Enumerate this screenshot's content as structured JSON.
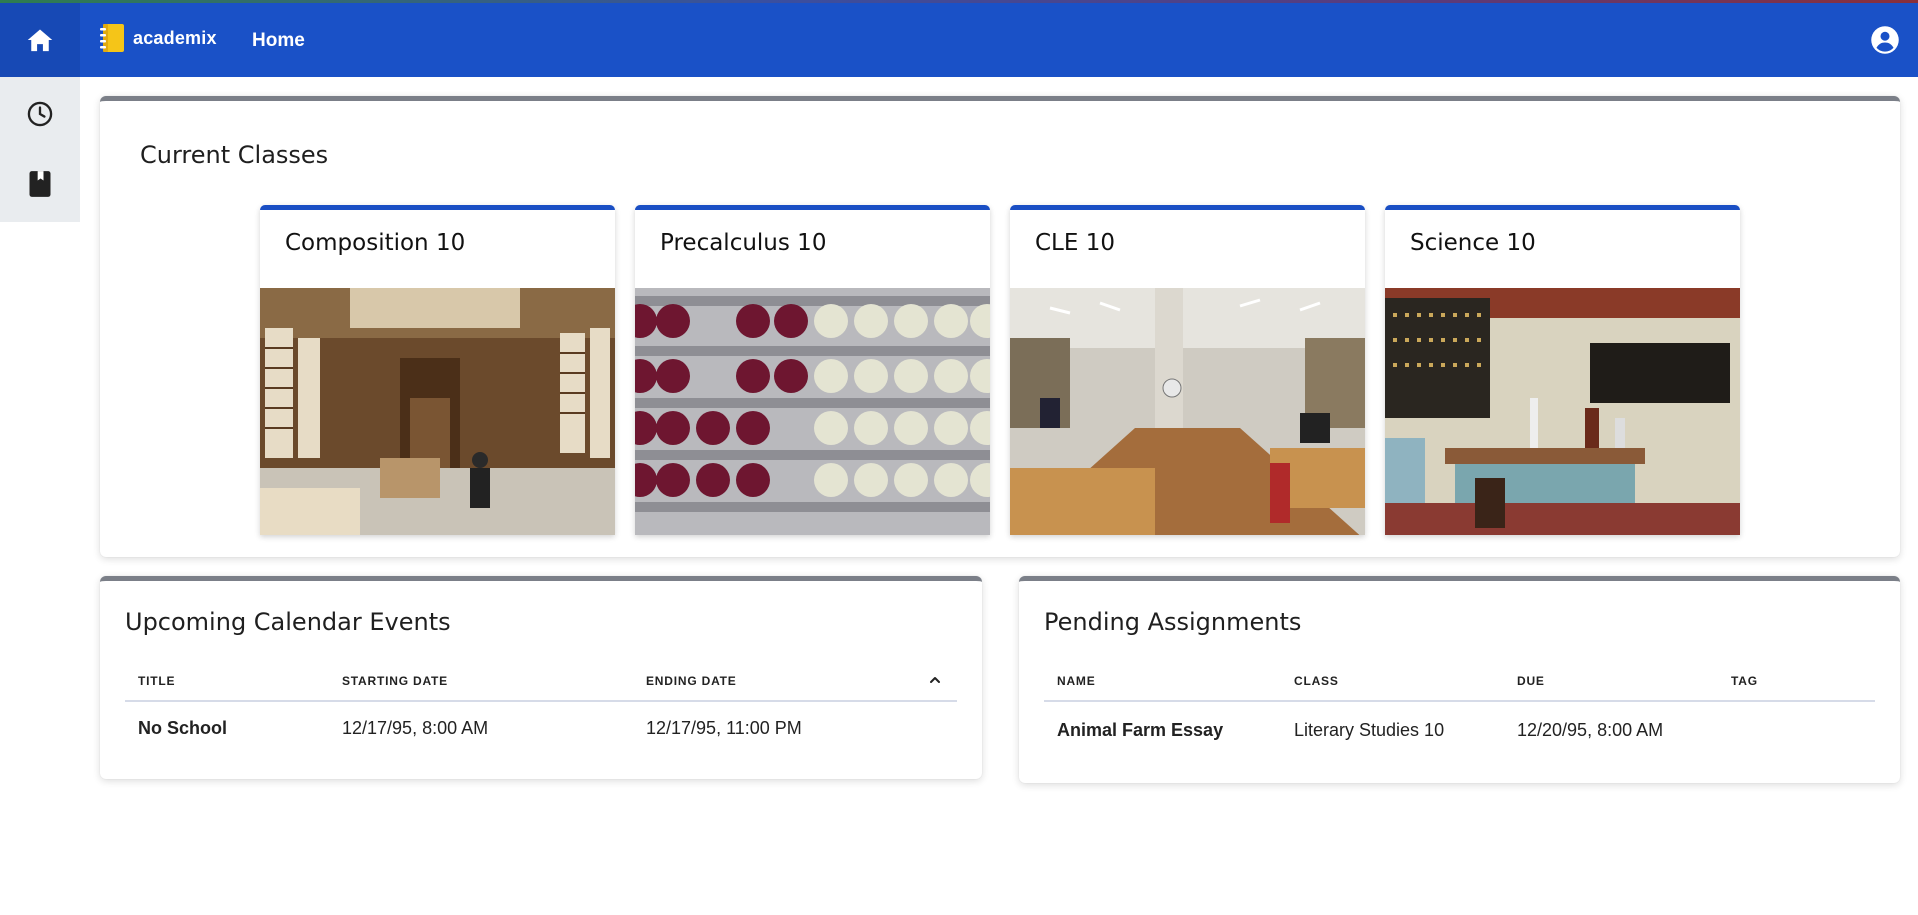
{
  "app": {
    "brand": "academix",
    "nav_home": "Home"
  },
  "colors": {
    "topbar": "#1a51c7",
    "accent": "#1a4fc4",
    "card_border": "#7b7f88",
    "sidebar_bg": "#e9ecef"
  },
  "icons": {
    "home": "home-icon",
    "history": "clock-icon",
    "library": "book-icon",
    "account": "account-circle-icon",
    "sort": "chevron-up-icon"
  },
  "current_classes": {
    "title": "Current Classes",
    "classes": [
      {
        "name": "Composition 10",
        "image": "library interior photo"
      },
      {
        "name": "Precalculus 10",
        "image": "abacus beads photo"
      },
      {
        "name": "CLE 10",
        "image": "open-plan office photo"
      },
      {
        "name": "Science 10",
        "image": "laboratory photo"
      }
    ]
  },
  "events": {
    "title": "Upcoming Calendar Events",
    "columns": [
      "TITLE",
      "STARTING DATE",
      "ENDING DATE"
    ],
    "rows": [
      {
        "title": "No School",
        "start": "12/17/95, 8:00 AM",
        "end": "12/17/95, 11:00 PM"
      }
    ]
  },
  "assignments": {
    "title": "Pending Assignments",
    "columns": [
      "NAME",
      "CLASS",
      "DUE",
      "TAG"
    ],
    "rows": [
      {
        "name": "Animal Farm Essay",
        "class": "Literary Studies 10",
        "due": "12/20/95, 8:00 AM",
        "tag": ""
      }
    ]
  }
}
